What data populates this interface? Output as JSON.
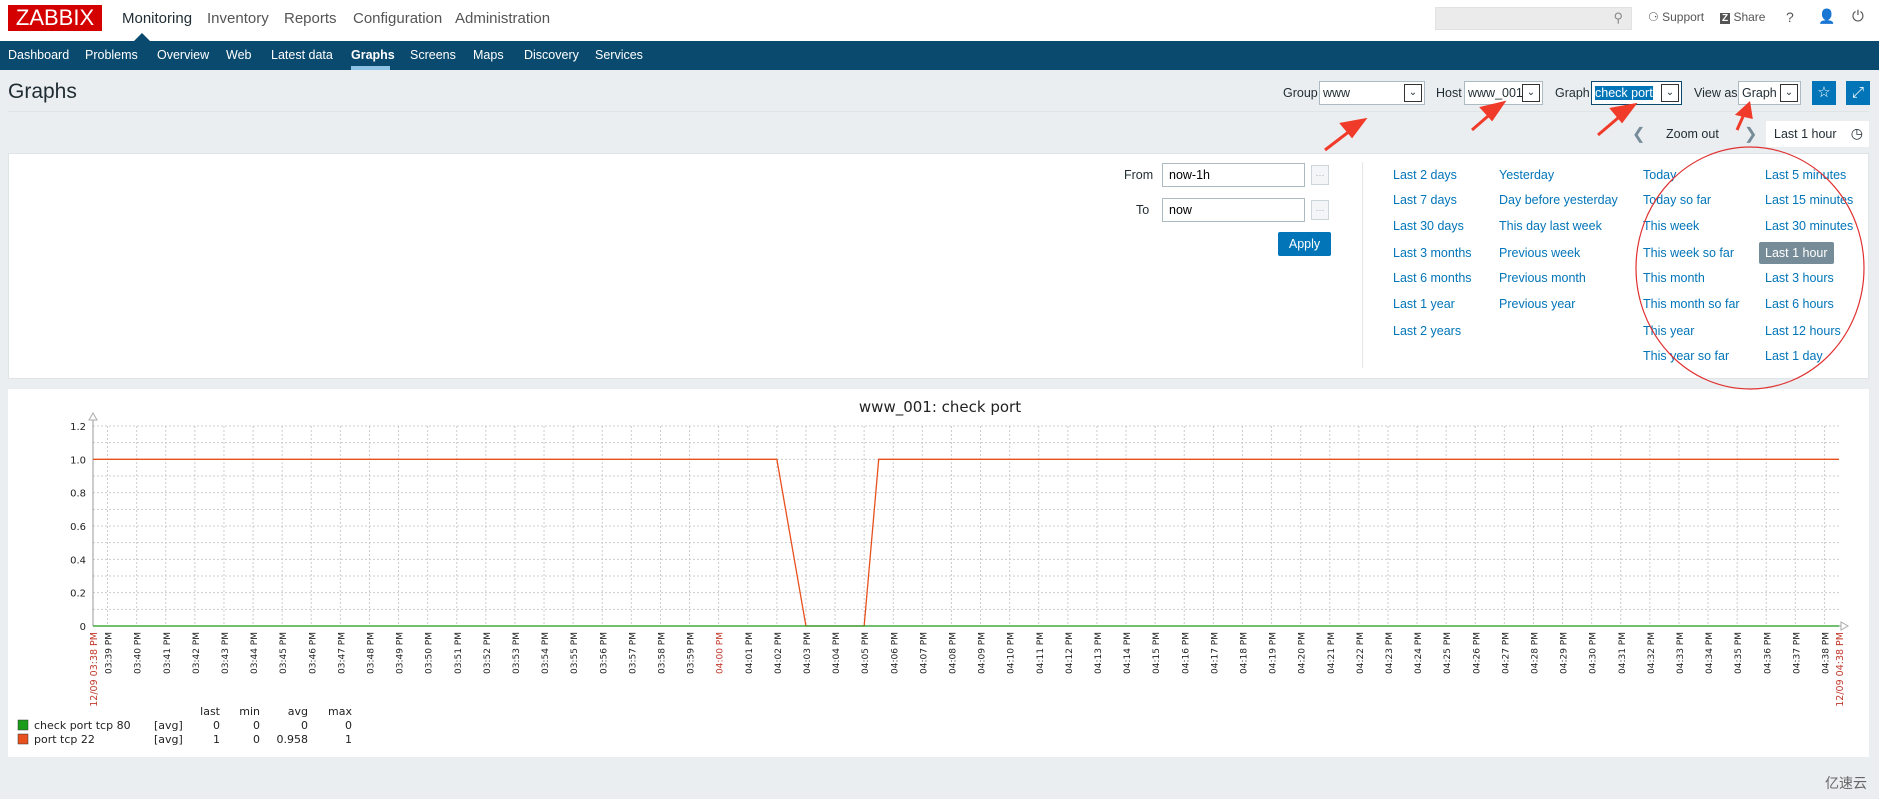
{
  "header": {
    "logo": "ZABBIX",
    "menu": [
      "Monitoring",
      "Inventory",
      "Reports",
      "Configuration",
      "Administration"
    ],
    "active_menu": "Monitoring",
    "search": {
      "value": "",
      "placeholder": ""
    },
    "support": "Support",
    "share": "Share",
    "help": "?"
  },
  "subnav": {
    "items": [
      "Dashboard",
      "Problems",
      "Overview",
      "Web",
      "Latest data",
      "Graphs",
      "Screens",
      "Maps",
      "Discovery",
      "Services"
    ],
    "active": "Graphs"
  },
  "page": {
    "title": "Graphs"
  },
  "filter": {
    "group_label": "Group",
    "group_value": "www",
    "host_label": "Host",
    "host_value": "www_001",
    "graph_label": "Graph",
    "graph_value": "check port",
    "view_label": "View as",
    "view_value": "Graph"
  },
  "timebar": {
    "zoom_out": "Zoom out",
    "current": "Last 1 hour"
  },
  "timepicker": {
    "from_label": "From",
    "from_value": "now-1h",
    "to_label": "To",
    "to_value": "now",
    "apply": "Apply",
    "columns": [
      [
        "Last 2 days",
        "Last 7 days",
        "Last 30 days",
        "Last 3 months",
        "Last 6 months",
        "Last 1 year",
        "Last 2 years"
      ],
      [
        "Yesterday",
        "Day before yesterday",
        "This day last week",
        "Previous week",
        "Previous month",
        "Previous year"
      ],
      [
        "Today",
        "Today so far",
        "This week",
        "This week so far",
        "This month",
        "This month so far",
        "This year",
        "This year so far"
      ],
      [
        "Last 5 minutes",
        "Last 15 minutes",
        "Last 30 minutes",
        "Last 1 hour",
        "Last 3 hours",
        "Last 6 hours",
        "Last 12 hours",
        "Last 1 day"
      ]
    ],
    "selected": "Last 1 hour"
  },
  "chart_data": {
    "type": "line",
    "title": "www_001: check port",
    "ylim": [
      0,
      1.2
    ],
    "y_ticks": [
      "0",
      "0.2",
      "0.4",
      "0.6",
      "0.8",
      "1.0",
      "1.2"
    ],
    "xlim": [
      "15:38:30",
      "16:38:30"
    ],
    "x_start_label": "12/09 03:38 PM",
    "x_end_label": "12/09 04:38 PM",
    "x_tick_labels": [
      "03:39 PM",
      "03:40 PM",
      "03:41 PM",
      "03:42 PM",
      "03:43 PM",
      "03:44 PM",
      "03:45 PM",
      "03:46 PM",
      "03:47 PM",
      "03:48 PM",
      "03:49 PM",
      "03:50 PM",
      "03:51 PM",
      "03:52 PM",
      "03:53 PM",
      "03:54 PM",
      "03:55 PM",
      "03:56 PM",
      "03:57 PM",
      "03:58 PM",
      "03:59 PM",
      "04:00 PM",
      "04:01 PM",
      "04:02 PM",
      "04:03 PM",
      "04:04 PM",
      "04:05 PM",
      "04:06 PM",
      "04:07 PM",
      "04:08 PM",
      "04:09 PM",
      "04:10 PM",
      "04:11 PM",
      "04:12 PM",
      "04:13 PM",
      "04:14 PM",
      "04:15 PM",
      "04:16 PM",
      "04:17 PM",
      "04:18 PM",
      "04:19 PM",
      "04:20 PM",
      "04:21 PM",
      "04:22 PM",
      "04:23 PM",
      "04:24 PM",
      "04:25 PM",
      "04:26 PM",
      "04:27 PM",
      "04:28 PM",
      "04:29 PM",
      "04:30 PM",
      "04:31 PM",
      "04:32 PM",
      "04:33 PM",
      "04:34 PM",
      "04:35 PM",
      "04:36 PM",
      "04:37 PM",
      "04:38 PM"
    ],
    "highlight_tick": "04:00 PM",
    "grid": true,
    "legend_headers": [
      "last",
      "min",
      "avg",
      "max"
    ],
    "series": [
      {
        "name": "check port tcp 80",
        "func": "[avg]",
        "color": "#1a9b1a",
        "last": "0",
        "min": "0",
        "avg": "0",
        "max": "0",
        "points": [
          [
            "15:38:30",
            0
          ],
          [
            "16:38:30",
            0
          ]
        ]
      },
      {
        "name": "port tcp 22",
        "func": "[avg]",
        "color": "#e8501e",
        "last": "1",
        "min": "0",
        "avg": "0.958",
        "max": "1",
        "points": [
          [
            "15:38:30",
            1
          ],
          [
            "16:02:00",
            1
          ],
          [
            "16:03:00",
            0
          ],
          [
            "16:05:00",
            0
          ],
          [
            "16:05:30",
            1
          ],
          [
            "16:38:30",
            1
          ]
        ]
      }
    ]
  },
  "watermark": "亿速云"
}
